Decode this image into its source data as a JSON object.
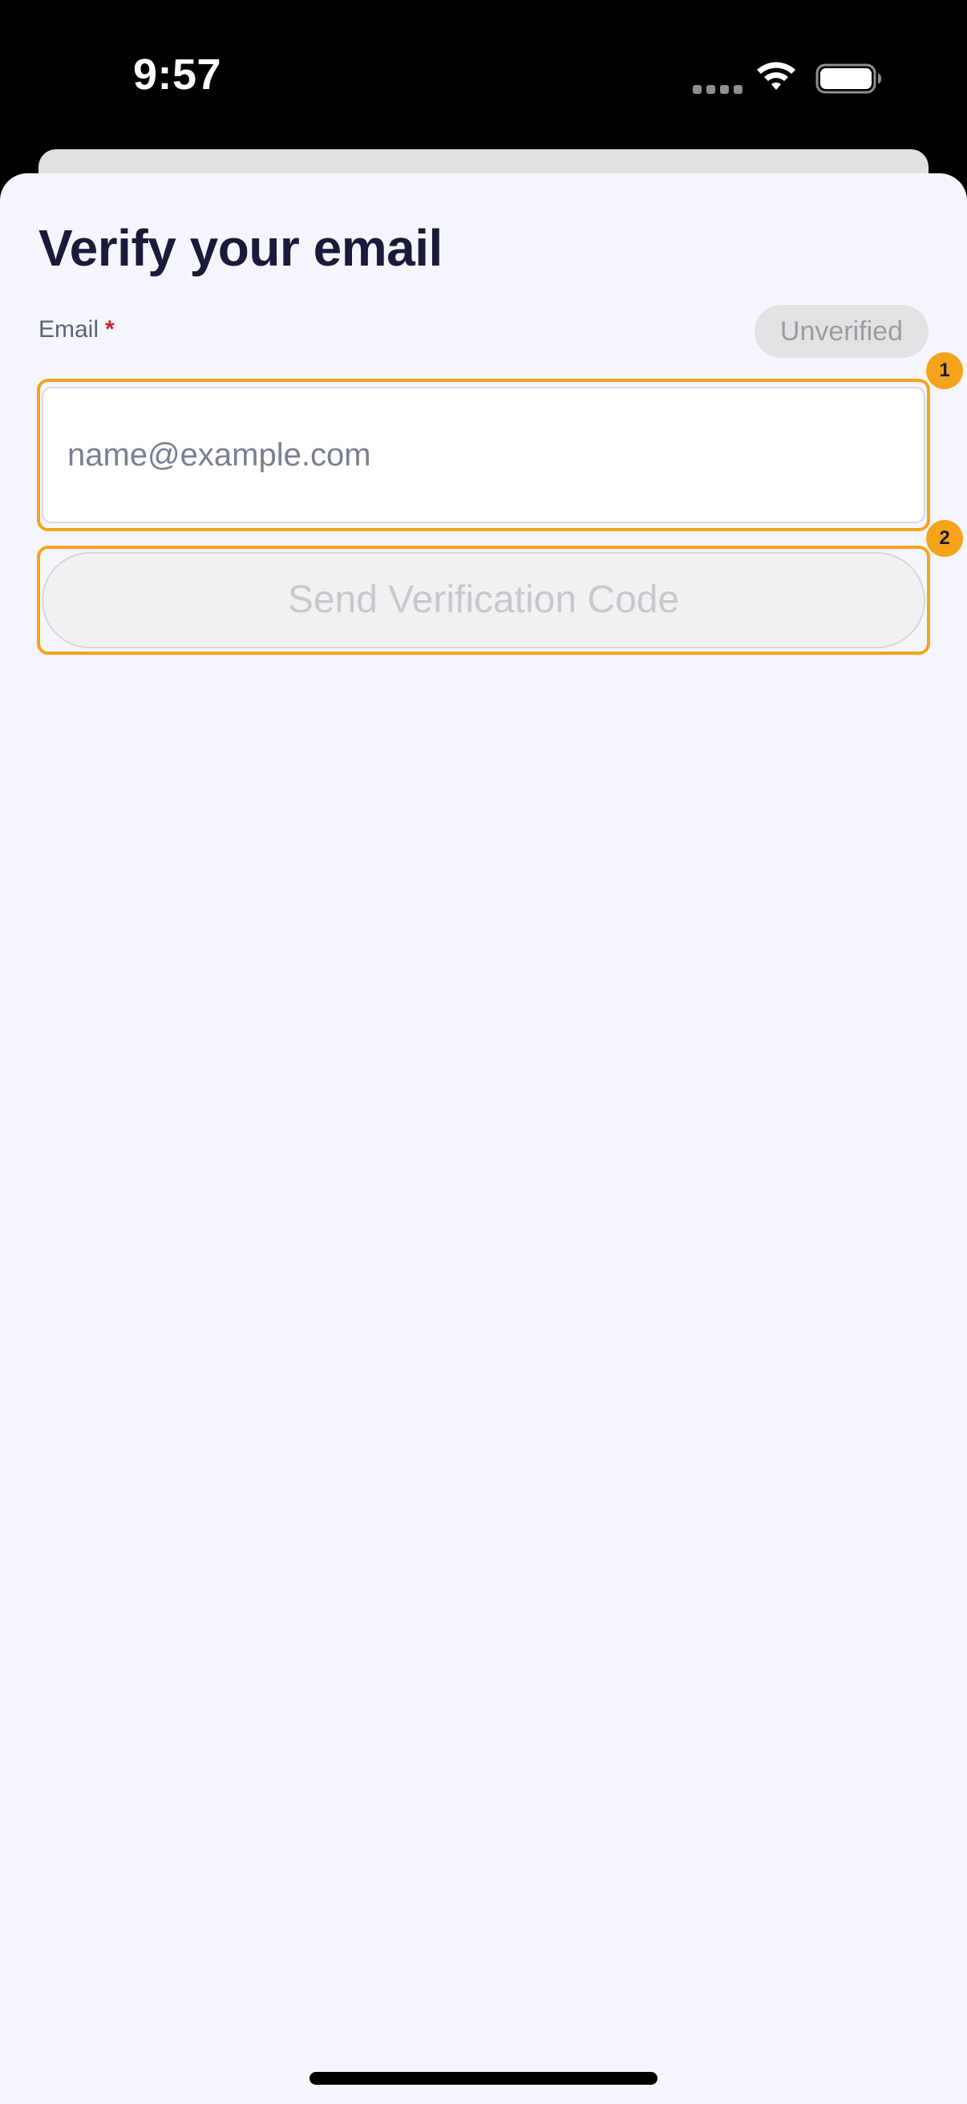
{
  "status_bar": {
    "time": "9:57",
    "icons": [
      "signal-dots-icon",
      "wifi-icon",
      "battery-icon"
    ]
  },
  "page": {
    "title": "Verify your email"
  },
  "email_field": {
    "label": "Email",
    "required_mark": "*",
    "status_badge": "Unverified",
    "placeholder": "name@example.com",
    "value": ""
  },
  "send_button": {
    "label": "Send Verification Code",
    "enabled": false
  },
  "annotations": {
    "marker_1": "1",
    "marker_2": "2",
    "highlight_color": "#f5a31a"
  },
  "colors": {
    "sheet_background": "#f5f6fd",
    "title_text": "#1c1a3a",
    "required_mark": "#c62828",
    "badge_background": "#e2e2e4"
  }
}
